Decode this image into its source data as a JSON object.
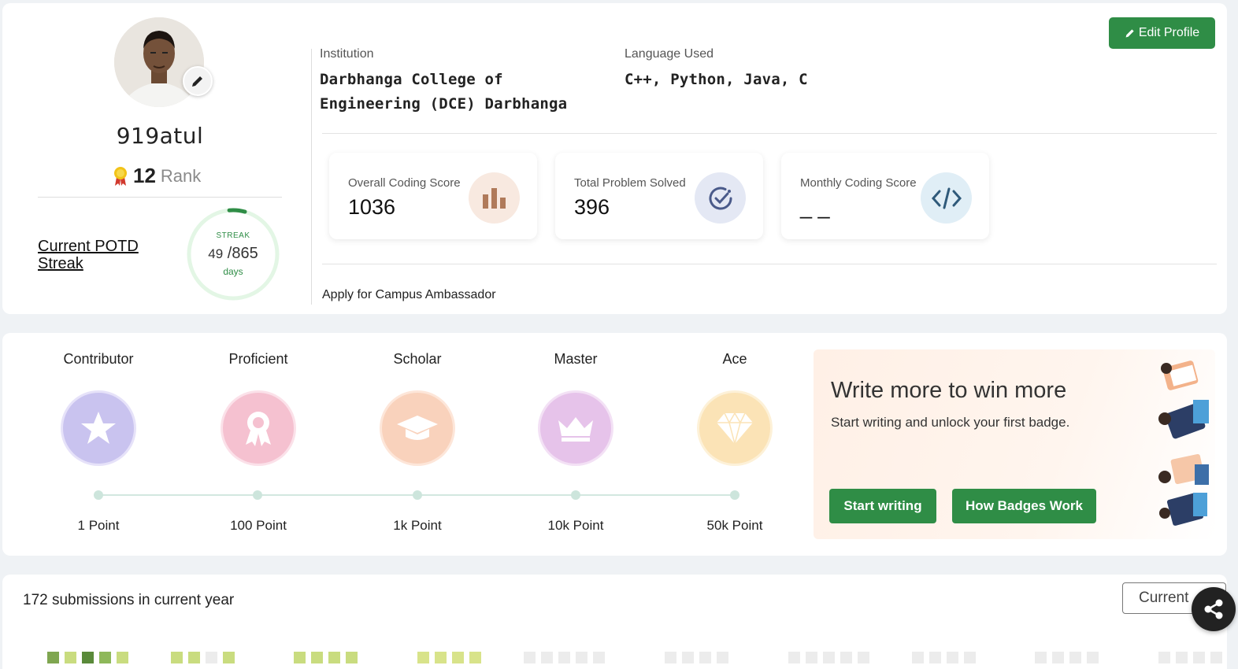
{
  "profile": {
    "username": "919atul",
    "rank_number": "12",
    "rank_label": "Rank",
    "potd_link": "Current POTD Streak",
    "streak": {
      "label": "STREAK",
      "current": "49",
      "total": "/865",
      "unit": "days",
      "progress": 0.057
    },
    "institution_label": "Institution",
    "institution_value": "Darbhanga College of Engineering (DCE) Darbhanga",
    "language_label": "Language Used",
    "language_value": "C++, Python, Java, C",
    "edit_button": "Edit Profile",
    "ambassador_link": "Apply for Campus Ambassador"
  },
  "stats": [
    {
      "label": "Overall Coding Score",
      "value": "1036",
      "icon": "bar-chart-icon",
      "icon_bg": "#f8e9e0",
      "icon_color": "#b07a5a"
    },
    {
      "label": "Total Problem Solved",
      "value": "396",
      "icon": "check-circle-icon",
      "icon_bg": "#e4e8f4",
      "icon_color": "#4a5a8a"
    },
    {
      "label": "Monthly Coding Score",
      "value": "_ _",
      "icon": "code-icon",
      "icon_bg": "#e0eef6",
      "icon_color": "#2f5a7a"
    }
  ],
  "badges": [
    {
      "title": "Contributor",
      "points": "1 Point",
      "color": "#c9c3ef",
      "ring": "#e6e2f9",
      "icon": "star-icon"
    },
    {
      "title": "Proficient",
      "points": "100 Point",
      "color": "#f5c1d0",
      "ring": "#fbe1e9",
      "icon": "ribbon-icon"
    },
    {
      "title": "Scholar",
      "points": "1k Point",
      "color": "#f9d2bc",
      "ring": "#fde6d9",
      "icon": "graduation-cap-icon"
    },
    {
      "title": "Master",
      "points": "10k Point",
      "color": "#e6c3ea",
      "ring": "#f3e1f5",
      "icon": "crown-icon"
    },
    {
      "title": "Ace",
      "points": "50k Point",
      "color": "#fbe3b6",
      "ring": "#fdf1d8",
      "icon": "diamond-icon"
    }
  ],
  "promo": {
    "title": "Write more to win more",
    "subtitle": "Start writing and unlock your first badge.",
    "start_button": "Start writing",
    "how_button": "How Badges Work"
  },
  "submissions": {
    "summary": "172 submissions in current year",
    "year_select": "Current"
  },
  "colors": {
    "accent": "#2f8d46"
  }
}
